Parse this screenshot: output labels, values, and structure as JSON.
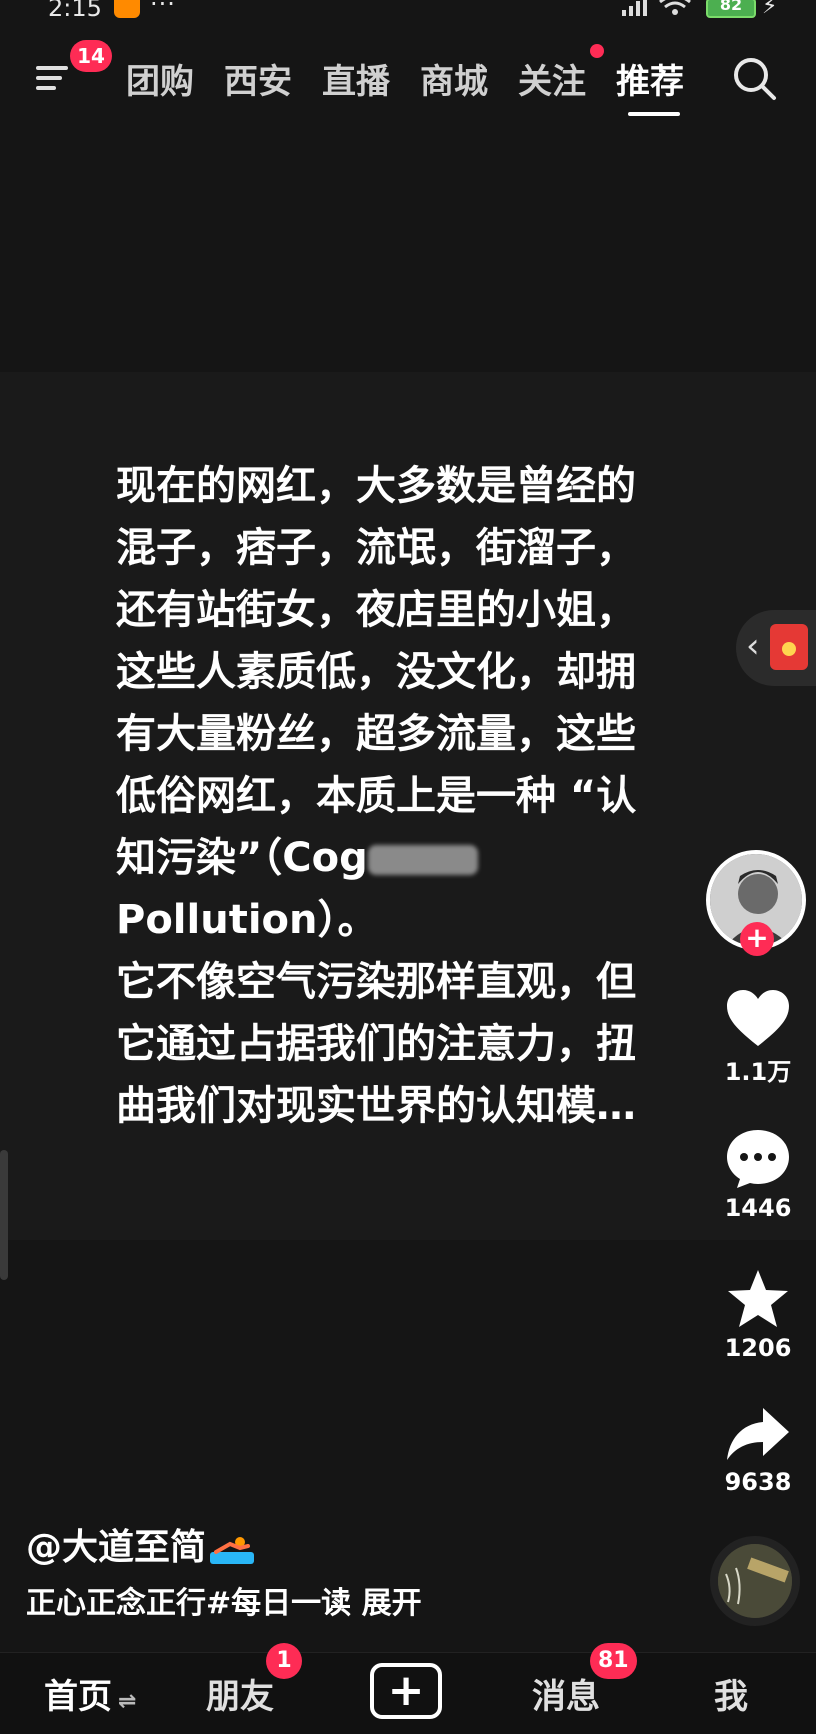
{
  "status_bar": {
    "time": "2:15",
    "dots": "···",
    "battery": "82"
  },
  "top_nav": {
    "menu_badge": "14",
    "tabs": [
      "团购",
      "西安",
      "直播",
      "商城",
      "关注",
      "推荐"
    ],
    "active_tab": "推荐"
  },
  "video": {
    "lines": [
      "现在的网红，大多数是曾经的",
      "混子，痞子，流氓，街溜子，",
      "还有站街女，夜店里的小姐，",
      "这些人素质低，没文化，却拥",
      "有大量粉丝，超多流量，这些",
      "低俗网红，本质上是一种 “认",
      "知污染”（Cog",
      "Pollution）。",
      "它不像空气污染那样直观，但",
      "它通过占据我们的注意力，扭",
      "曲我们对现实世界的认知模…"
    ]
  },
  "actions": {
    "like_count": "1.1万",
    "comment_count": "1446",
    "favorite_count": "1206",
    "share_count": "9638"
  },
  "caption": {
    "author": "@大道至简",
    "text": "正心正念正行#每日一读 展开"
  },
  "bottom_nav": {
    "home": "首页",
    "home_swap": "⇌",
    "friends": "朋友",
    "friends_badge": "1",
    "add": "+",
    "messages": "消息",
    "messages_badge": "81",
    "me": "我"
  },
  "colors": {
    "accent": "#fe2c55",
    "background": "#151515"
  }
}
